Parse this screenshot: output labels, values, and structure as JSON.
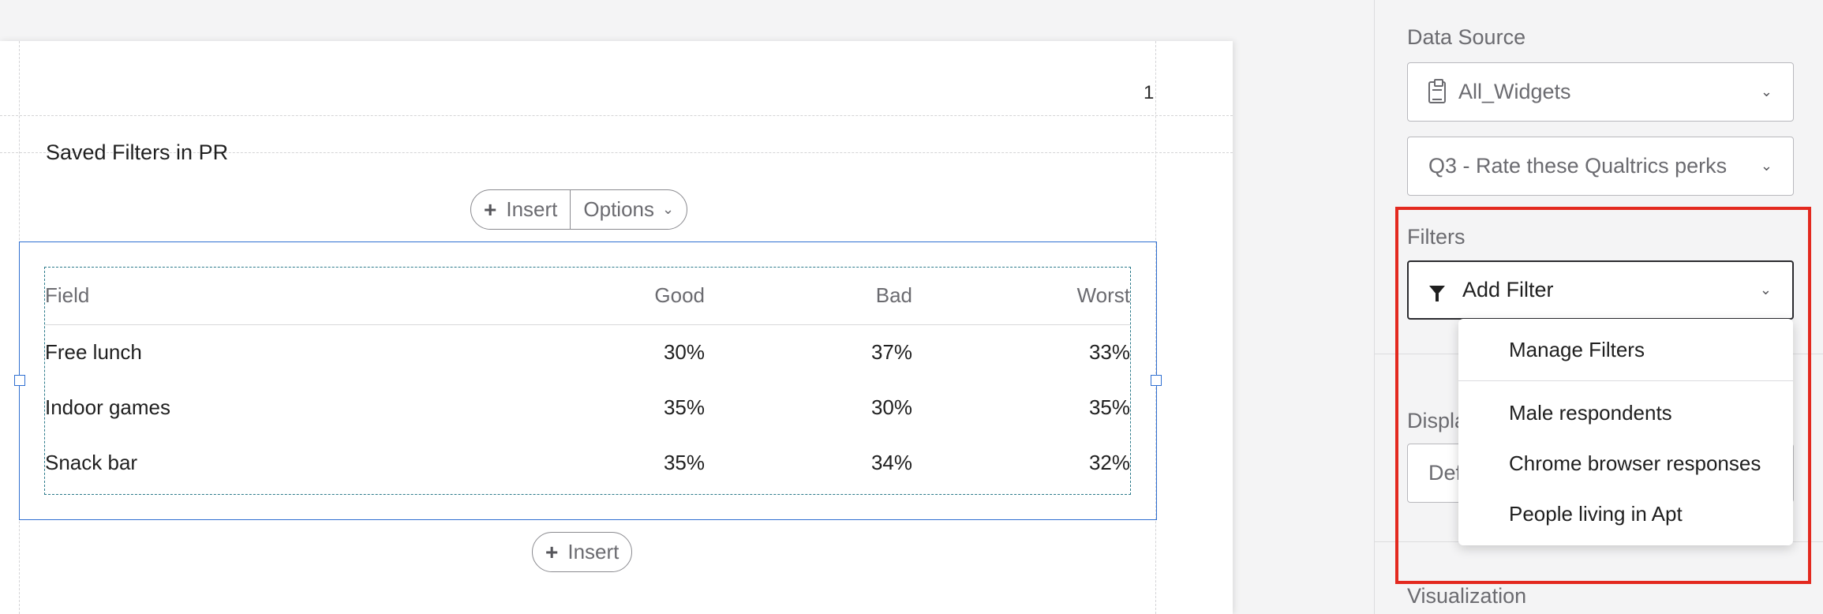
{
  "canvas": {
    "page_number": "1",
    "widget_title": "Saved Filters in PR",
    "toolbar": {
      "insert_label": "Insert",
      "options_label": "Options"
    },
    "bottom_insert_label": "Insert",
    "table": {
      "headers": [
        "Field",
        "Good",
        "Bad",
        "Worst"
      ],
      "rows": [
        [
          "Free lunch",
          "30%",
          "37%",
          "33%"
        ],
        [
          "Indoor games",
          "35%",
          "30%",
          "35%"
        ],
        [
          "Snack bar",
          "35%",
          "34%",
          "32%"
        ]
      ]
    }
  },
  "panel": {
    "data_source_label": "Data Source",
    "data_source_value": "All_Widgets",
    "data_source_icon": "clipboard-icon",
    "question_value": "Q3 - Rate these Qualtrics perks",
    "filters_label": "Filters",
    "add_filter_label": "Add Filter",
    "filter_icon": "funnel-icon",
    "display_label_partial": "Displa",
    "display_value_partial": "Def",
    "visualization_label": "Visualization",
    "highlight_color": "#e3291f",
    "dropdown": {
      "manage": "Manage Filters",
      "items": [
        "Male respondents",
        "Chrome browser responses",
        "People living in Apt"
      ]
    }
  }
}
